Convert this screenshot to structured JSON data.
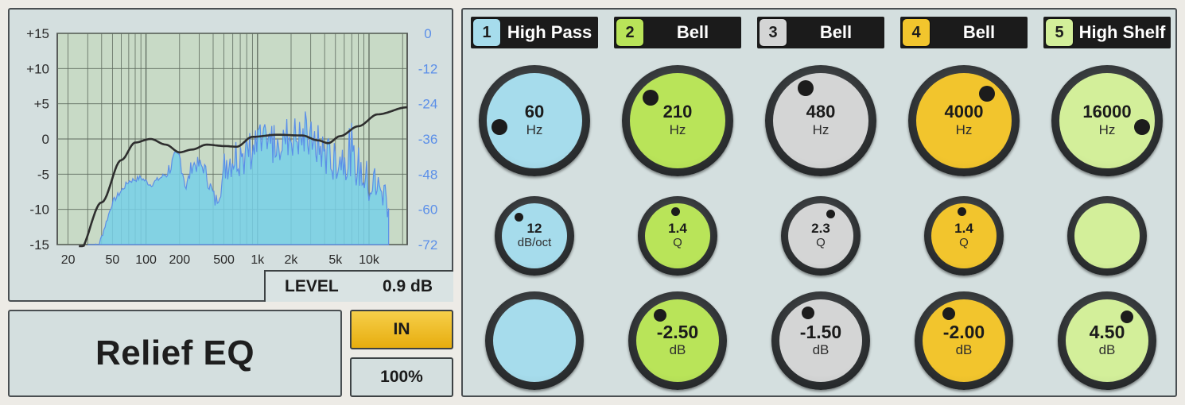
{
  "colors": {
    "band1": "#a6dcec",
    "band2": "#b9e459",
    "band3": "#d4d5d5",
    "band4": "#f2c52d",
    "band5": "#d3ef9a",
    "spectrum": "#77d0e7",
    "spectrum_line": "#5b8fe8",
    "curve": "#2e2e2e",
    "grid_bg": "#c8dac6",
    "right_axis_text": "#5b8fe8"
  },
  "graph": {
    "left_ticks": [
      "+15",
      "+10",
      "+5",
      "0",
      "-5",
      "-10",
      "-15"
    ],
    "right_ticks": [
      "0",
      "-12",
      "-24",
      "-36",
      "-48",
      "-60",
      "-72"
    ],
    "freq_ticks": [
      "20",
      "50",
      "100",
      "200",
      "500",
      "1k",
      "2k",
      "5k",
      "10k"
    ],
    "freq_tick_values": [
      20,
      50,
      100,
      200,
      500,
      1000,
      2000,
      5000,
      10000
    ],
    "level_label": "LEVEL",
    "level_value": "0.9 dB"
  },
  "plugin_name": "Relief EQ",
  "in_button": "IN",
  "mix_value": "100%",
  "bands": [
    {
      "num": "1",
      "type": "High Pass",
      "color": "#a6dcec",
      "freq": "60",
      "freq_unit": "Hz",
      "freq_dot_angle": 260,
      "second": "12",
      "second_unit": "dB/oct",
      "second_dot_angle": 320,
      "gain": "",
      "gain_unit": "",
      "gain_dot_angle": null
    },
    {
      "num": "2",
      "type": "Bell",
      "color": "#b9e459",
      "freq": "210",
      "freq_unit": "Hz",
      "freq_dot_angle": 310,
      "second": "1.4",
      "second_unit": "Q",
      "second_dot_angle": 355,
      "gain": "-2.50",
      "gain_unit": "dB",
      "gain_dot_angle": 325
    },
    {
      "num": "3",
      "type": "Bell",
      "color": "#d4d5d5",
      "freq": "480",
      "freq_unit": "Hz",
      "freq_dot_angle": 335,
      "second": "2.3",
      "second_unit": "Q",
      "second_dot_angle": 25,
      "gain": "-1.50",
      "gain_unit": "dB",
      "gain_dot_angle": 335
    },
    {
      "num": "4",
      "type": "Bell",
      "color": "#f2c52d",
      "freq": "4000",
      "freq_unit": "Hz",
      "freq_dot_angle": 40,
      "second": "1.4",
      "second_unit": "Q",
      "second_dot_angle": 355,
      "gain": "-2.00",
      "gain_unit": "dB",
      "gain_dot_angle": 330
    },
    {
      "num": "5",
      "type": "High Shelf",
      "color": "#d3ef9a",
      "freq": "16000",
      "freq_unit": "Hz",
      "freq_dot_angle": 100,
      "second": "",
      "second_unit": "",
      "second_dot_angle": null,
      "gain": "4.50",
      "gain_unit": "dB",
      "gain_dot_angle": 40
    }
  ]
}
